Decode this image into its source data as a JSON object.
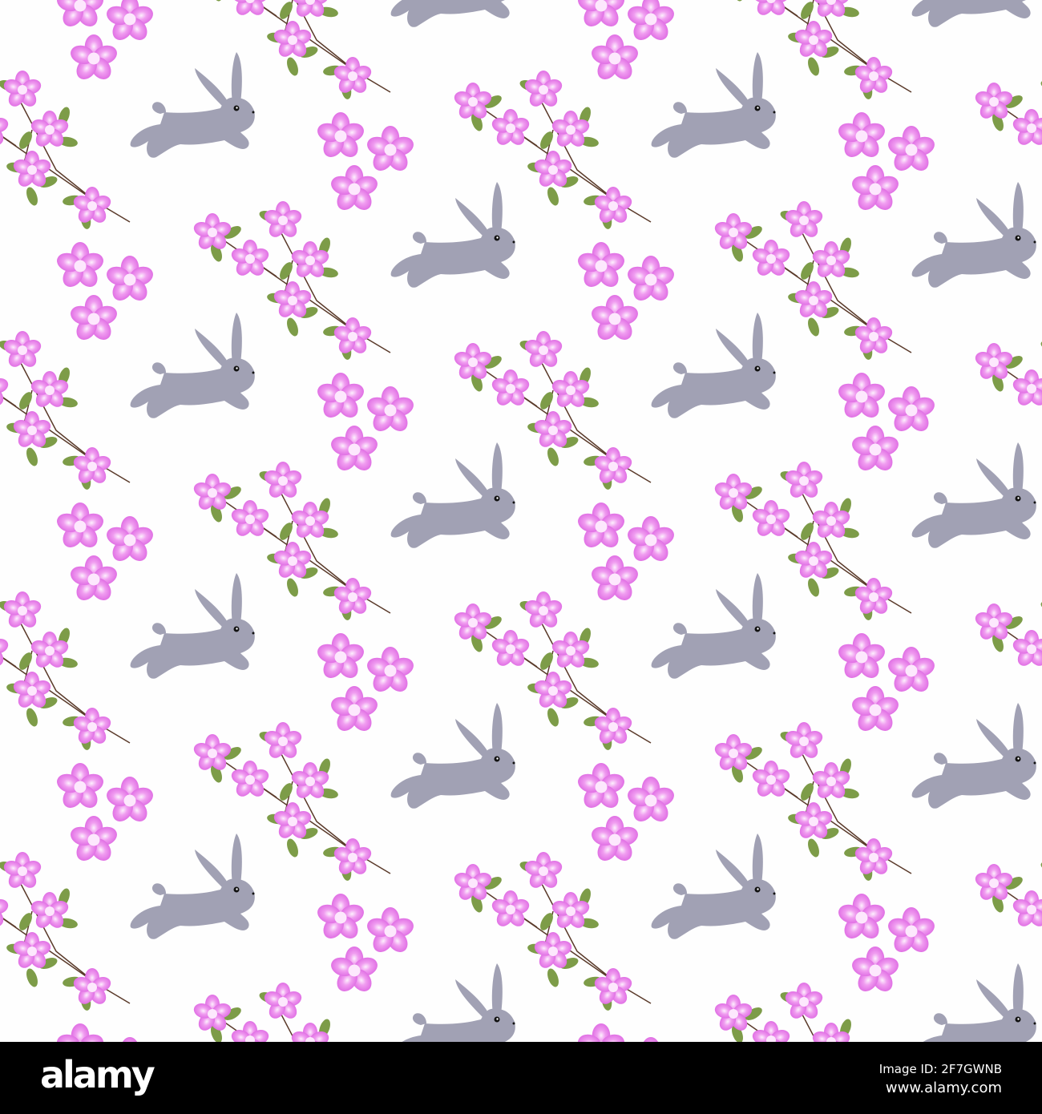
{
  "footer": {
    "logo": "alamy",
    "image_id": "Image ID: 2F7GWNB",
    "url": "www.alamy.com"
  },
  "colors": {
    "background": "#fefefe",
    "bunny": "#a1a1b4",
    "flower": "#e77ae9",
    "flower_center": "#fbe6fb",
    "leaf": "#7a9a45",
    "stem": "#5a3a2a",
    "footer": "#000000"
  }
}
